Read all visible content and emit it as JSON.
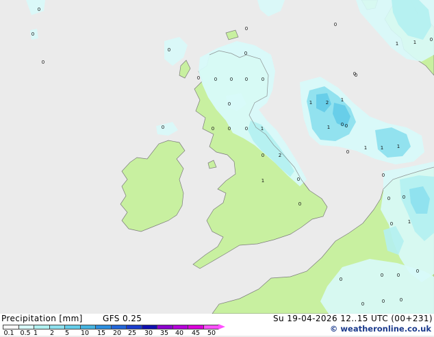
{
  "title": "Precipitation [mm]",
  "model": "GFS 0.25",
  "valid_time": "Su 19-04-2026 12..15 UTC (00+231)",
  "brand": "© weatheronline.co.uk",
  "legend": {
    "ticks": [
      "0.1",
      "0.5",
      "1",
      "2",
      "5",
      "10",
      "15",
      "20",
      "25",
      "30",
      "35",
      "40",
      "45",
      "50"
    ],
    "colors": [
      "#ffffff",
      "#d8fafa",
      "#b0f0f0",
      "#8ee0ee",
      "#64cce8",
      "#46b4e0",
      "#2c8ede",
      "#2266d8",
      "#1a3ccc",
      "#1010b0",
      "#8a00cc",
      "#b400d8",
      "#d800d8",
      "#ff50ff"
    ]
  },
  "map_labels": {
    "points": [
      "0",
      "0",
      "0",
      "0",
      "0",
      "0",
      "0",
      "0",
      "0",
      "0",
      "0",
      "0",
      "0",
      "0",
      "0",
      "0",
      "1",
      "0",
      "2",
      "1",
      "0",
      "1",
      "2",
      "1",
      "0",
      "1",
      "0",
      "0",
      "1",
      "1",
      "1",
      "0",
      "0",
      "0",
      "1",
      "1",
      "0",
      "0",
      "0",
      "1",
      "0",
      "0",
      "0",
      "0",
      "0",
      "0",
      "0",
      "0",
      "0",
      "0"
    ]
  },
  "colors": {
    "background": "#ebebeb",
    "land": "#c8f0a0",
    "precip_light": "#b4f0f0",
    "precip_medium": "#8ee0ee",
    "precip_heavy": "#64cce8",
    "coastline": "#7a7a7a",
    "brand_blue": "#1a3a8c"
  }
}
